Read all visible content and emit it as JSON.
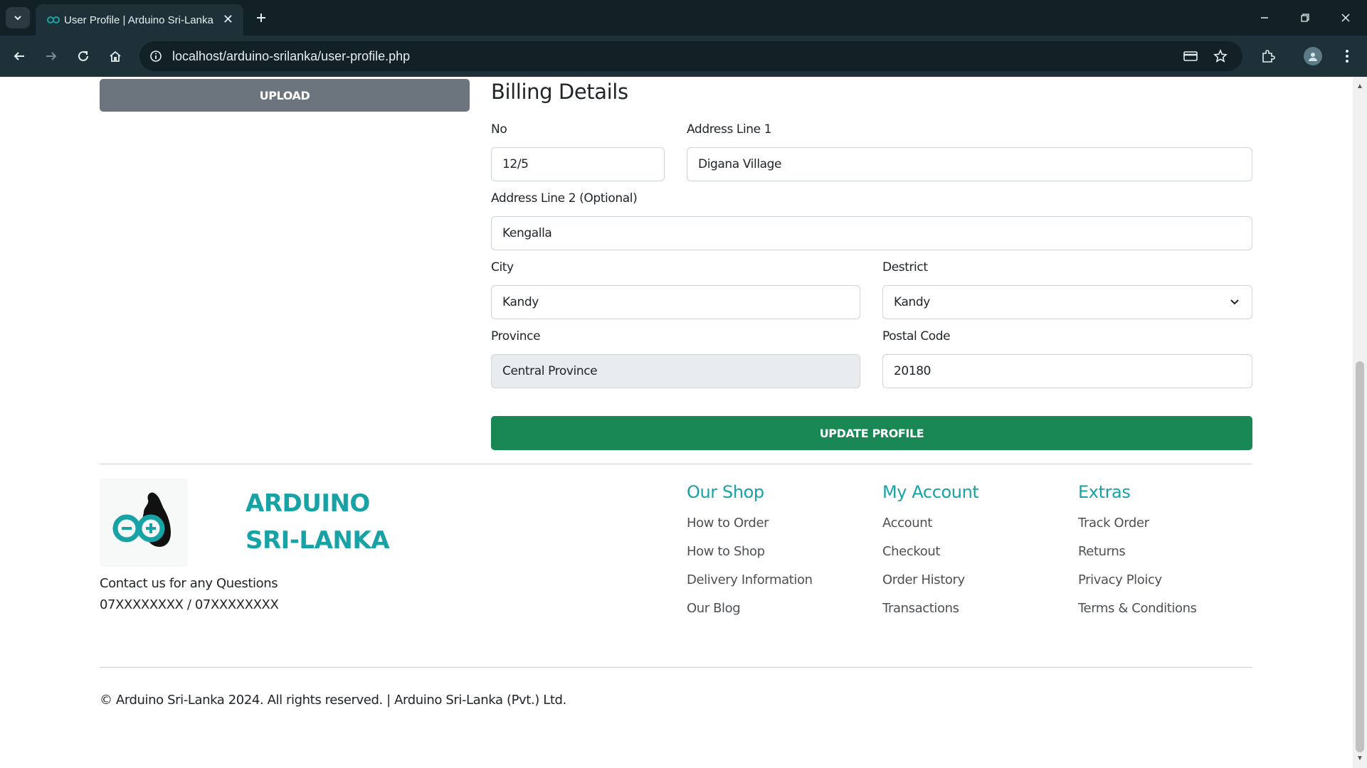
{
  "browser": {
    "tab_title": "User Profile | Arduino Sri-Lanka",
    "tab_close": "✕",
    "new_tab": "+",
    "url": "localhost/arduino-srilanka/user-profile.php"
  },
  "page": {
    "upload_label": "UPLOAD",
    "billing": {
      "title": "Billing Details",
      "no": {
        "label": "No",
        "value": "12/5"
      },
      "address1": {
        "label": "Address Line 1",
        "value": "Digana Village"
      },
      "address2": {
        "label": "Address Line 2 (Optional)",
        "value": "Kengalla"
      },
      "city": {
        "label": "City",
        "value": "Kandy"
      },
      "district": {
        "label": "Destrict",
        "value": "Kandy"
      },
      "province": {
        "label": "Province",
        "value": "Central Province"
      },
      "postal": {
        "label": "Postal Code",
        "value": "20180"
      }
    },
    "update_label": "UPDATE PROFILE"
  },
  "footer": {
    "brand_line1": "ARDUINO",
    "brand_line2": "SRI-LANKA",
    "contact_text": "Contact us for any Questions",
    "contact_phone": "07XXXXXXXX / 07XXXXXXXX",
    "columns": [
      {
        "title": "Our Shop",
        "links": [
          "How to Order",
          "How to Shop",
          "Delivery Information",
          "Our Blog"
        ]
      },
      {
        "title": "My Account",
        "links": [
          "Account",
          "Checkout",
          "Order History",
          "Transactions"
        ]
      },
      {
        "title": "Extras",
        "links": [
          "Track Order",
          "Returns",
          "Privacy Ploicy",
          "Terms & Conditions"
        ]
      }
    ],
    "copyright": "© Arduino Sri-Lanka 2024. All rights reserved. | Arduino Sri-Lanka (Pvt.) Ltd."
  },
  "colors": {
    "brand_teal": "#17a2a6",
    "update_green": "#198754",
    "upload_gray": "#6c757d",
    "chrome_dark": "#112126"
  }
}
